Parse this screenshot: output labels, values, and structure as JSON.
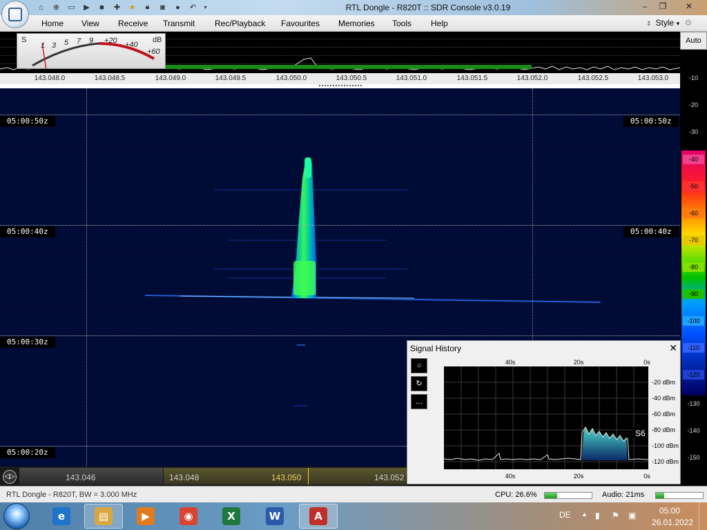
{
  "window": {
    "title": "RTL Dongle - R820T :: SDR Console v3.0.19",
    "controls": {
      "minimize": "–",
      "restore": "❐",
      "close": "✕"
    }
  },
  "quick_access": [
    "home-icon",
    "help-icon",
    "folder-icon",
    "play-icon",
    "stop-icon",
    "add-icon",
    "star-icon",
    "lock-icon",
    "camera-icon",
    "bulb-icon",
    "undo-icon",
    "dropdown-icon"
  ],
  "menu": [
    "Home",
    "View",
    "Receive",
    "Transmit",
    "Rec/Playback",
    "Favourites",
    "Memories",
    "Tools",
    "Help"
  ],
  "style_menu": {
    "label": "Style",
    "arrow": "▾",
    "updown": "⇕"
  },
  "smeter": {
    "s_label": "S",
    "db_label": "dB",
    "s_ticks": [
      "1",
      "3",
      "5",
      "7",
      "9"
    ],
    "db_ticks": [
      "+20",
      "+40",
      "+60"
    ]
  },
  "spectrum_axis": [
    "143.048.0",
    "143.048.5",
    "143.049.0",
    "143.049.5",
    "143.050.0",
    "143.050.5",
    "143.051.0",
    "143.051.5",
    "143.052.0",
    "143.052.5",
    "143.053.0"
  ],
  "right_scale": {
    "auto_label": "Auto",
    "plain_ticks_top": [
      "-10",
      "-20",
      "-30"
    ],
    "color_ticks": [
      "-40",
      "-50",
      "-60",
      "-70",
      "-80",
      "-90",
      "-100",
      "-110",
      "-120"
    ],
    "plain_ticks_bottom": [
      "-130",
      "-140",
      "-150"
    ],
    "color_tick_colors": [
      "#f0408c",
      "#ff3030",
      "#ff7a10",
      "#e8c800",
      "#80e000",
      "#20c000",
      "#20a0ff",
      "#3060ff",
      "#2040d0"
    ]
  },
  "waterfall": {
    "timestamps": [
      "05:00:50z",
      "05:00:40z",
      "05:00:30z",
      "05:00:20z"
    ]
  },
  "signal_history": {
    "title": "Signal History",
    "close": "✕",
    "tools": [
      "○",
      "↻",
      "…"
    ],
    "x_labels": [
      "40s",
      "20s",
      "0s"
    ],
    "y_labels": [
      "-20 dBm",
      "-40 dBm",
      "-60 dBm",
      "-80 dBm",
      "-100 dBm",
      "-120 dBm"
    ],
    "s_reading": "S6"
  },
  "bottom_bar": {
    "labels": [
      "143.046",
      "143.048",
      "143.050",
      "143.052"
    ],
    "button_glyph": "◁▷"
  },
  "status": {
    "left": "RTL Dongle - R820T, BW = 3.000 MHz",
    "cpu": "CPU: 26.6%",
    "cpu_fraction": 0.27,
    "audio": "Audio: 21ms",
    "audio_fraction": 0.18
  },
  "taskbar": {
    "apps": [
      {
        "name": "ie-icon",
        "glyph": "e",
        "color": "#1f73c9"
      },
      {
        "name": "explorer-icon",
        "glyph": "▤",
        "color": "#d9a640"
      },
      {
        "name": "media-player-icon",
        "glyph": "▶",
        "color": "#e07b20"
      },
      {
        "name": "chrome-icon",
        "glyph": "◉",
        "color": "#d94532"
      },
      {
        "name": "excel-icon",
        "glyph": "X",
        "color": "#1e7a3c"
      },
      {
        "name": "word-icon",
        "glyph": "W",
        "color": "#2a5aa8"
      },
      {
        "name": "sdr-console-icon",
        "glyph": "A",
        "color": "#c0302a"
      }
    ],
    "language": "DE",
    "time": "05:00",
    "date": "26.01.2022"
  }
}
